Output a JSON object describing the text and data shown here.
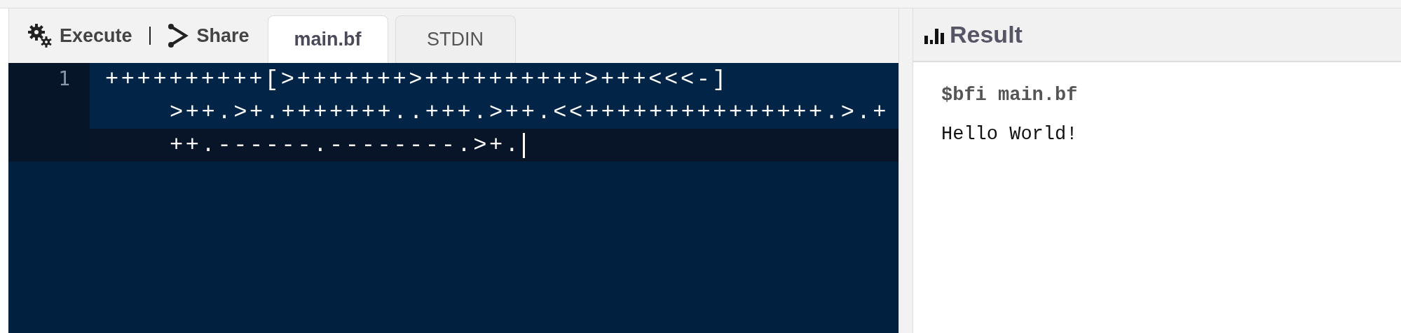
{
  "toolbar": {
    "buttons": [
      {
        "label": "Execute",
        "kind": "execute"
      },
      {
        "label": "Share",
        "kind": "share"
      }
    ]
  },
  "tabs": [
    {
      "label": "main.bf",
      "selected": true
    },
    {
      "label": "STDIN",
      "selected": false
    }
  ],
  "editor": {
    "lines": [
      {
        "number": "1",
        "active": true,
        "rows": [
          "++++++++++[>+++++++>++++++++++>+++<<<-]",
          ">++.>+.+++++++..+++.>++.<<+++++++++++++++.>.+",
          "++.------.--------.>+."
        ]
      }
    ]
  },
  "result": {
    "title": "Result",
    "command": "$bfi main.bf",
    "output": "Hello World!"
  }
}
